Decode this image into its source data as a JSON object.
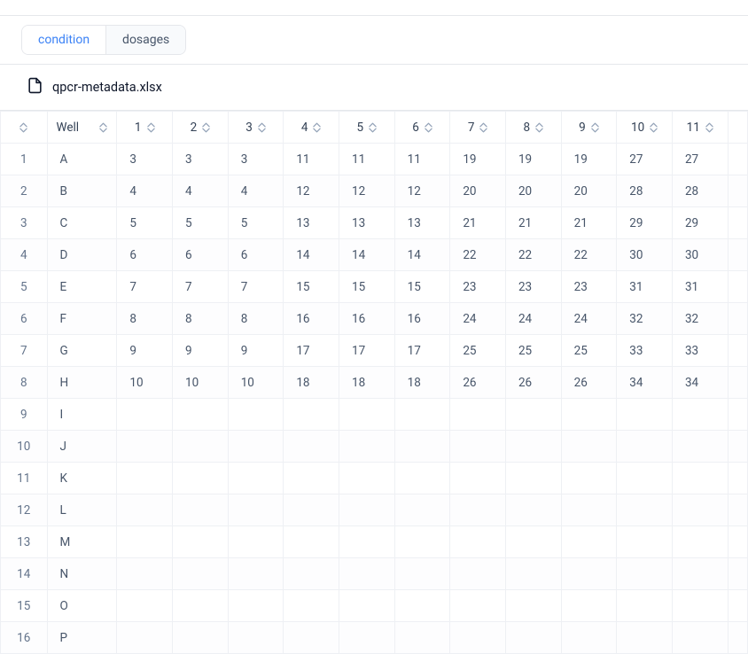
{
  "tabs": {
    "active": "condition",
    "items": [
      {
        "id": "condition",
        "label": "condition"
      },
      {
        "id": "dosages",
        "label": "dosages"
      }
    ]
  },
  "file": {
    "name": "qpcr-metadata.xlsx"
  },
  "table": {
    "header": {
      "well_label": "Well",
      "columns": [
        "1",
        "2",
        "3",
        "4",
        "5",
        "6",
        "7",
        "8",
        "9",
        "10",
        "11"
      ]
    },
    "rows": [
      {
        "n": "1",
        "well": "A",
        "cells": [
          "3",
          "3",
          "3",
          "11",
          "11",
          "11",
          "19",
          "19",
          "19",
          "27",
          "27"
        ]
      },
      {
        "n": "2",
        "well": "B",
        "cells": [
          "4",
          "4",
          "4",
          "12",
          "12",
          "12",
          "20",
          "20",
          "20",
          "28",
          "28"
        ]
      },
      {
        "n": "3",
        "well": "C",
        "cells": [
          "5",
          "5",
          "5",
          "13",
          "13",
          "13",
          "21",
          "21",
          "21",
          "29",
          "29"
        ]
      },
      {
        "n": "4",
        "well": "D",
        "cells": [
          "6",
          "6",
          "6",
          "14",
          "14",
          "14",
          "22",
          "22",
          "22",
          "30",
          "30"
        ]
      },
      {
        "n": "5",
        "well": "E",
        "cells": [
          "7",
          "7",
          "7",
          "15",
          "15",
          "15",
          "23",
          "23",
          "23",
          "31",
          "31"
        ]
      },
      {
        "n": "6",
        "well": "F",
        "cells": [
          "8",
          "8",
          "8",
          "16",
          "16",
          "16",
          "24",
          "24",
          "24",
          "32",
          "32"
        ]
      },
      {
        "n": "7",
        "well": "G",
        "cells": [
          "9",
          "9",
          "9",
          "17",
          "17",
          "17",
          "25",
          "25",
          "25",
          "33",
          "33"
        ]
      },
      {
        "n": "8",
        "well": "H",
        "cells": [
          "10",
          "10",
          "10",
          "18",
          "18",
          "18",
          "26",
          "26",
          "26",
          "34",
          "34"
        ]
      },
      {
        "n": "9",
        "well": "I",
        "cells": [
          "",
          "",
          "",
          "",
          "",
          "",
          "",
          "",
          "",
          "",
          ""
        ]
      },
      {
        "n": "10",
        "well": "J",
        "cells": [
          "",
          "",
          "",
          "",
          "",
          "",
          "",
          "",
          "",
          "",
          ""
        ]
      },
      {
        "n": "11",
        "well": "K",
        "cells": [
          "",
          "",
          "",
          "",
          "",
          "",
          "",
          "",
          "",
          "",
          ""
        ]
      },
      {
        "n": "12",
        "well": "L",
        "cells": [
          "",
          "",
          "",
          "",
          "",
          "",
          "",
          "",
          "",
          "",
          ""
        ]
      },
      {
        "n": "13",
        "well": "M",
        "cells": [
          "",
          "",
          "",
          "",
          "",
          "",
          "",
          "",
          "",
          "",
          ""
        ]
      },
      {
        "n": "14",
        "well": "N",
        "cells": [
          "",
          "",
          "",
          "",
          "",
          "",
          "",
          "",
          "",
          "",
          ""
        ]
      },
      {
        "n": "15",
        "well": "O",
        "cells": [
          "",
          "",
          "",
          "",
          "",
          "",
          "",
          "",
          "",
          "",
          ""
        ]
      },
      {
        "n": "16",
        "well": "P",
        "cells": [
          "",
          "",
          "",
          "",
          "",
          "",
          "",
          "",
          "",
          "",
          ""
        ]
      }
    ]
  }
}
